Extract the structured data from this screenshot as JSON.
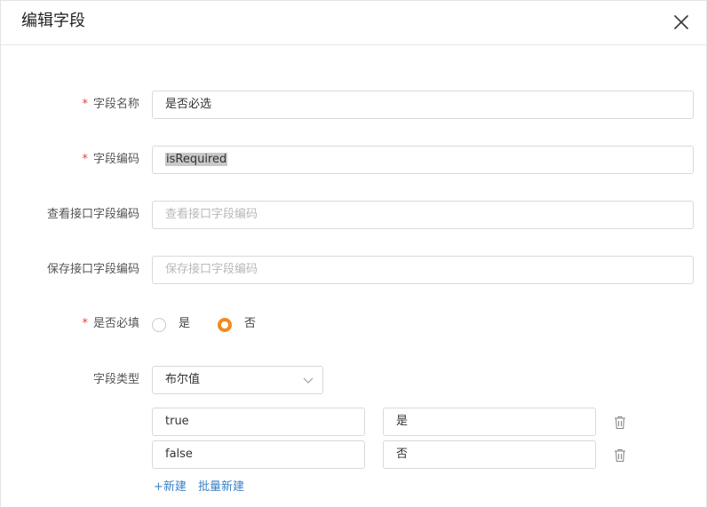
{
  "dialog": {
    "title": "编辑字段"
  },
  "form": {
    "field_name": {
      "label": "字段名称",
      "required": "*",
      "value": "是否必选"
    },
    "field_code": {
      "label": "字段编码",
      "required": "*",
      "value": "isRequired"
    },
    "view_api_code": {
      "label": "查看接口字段编码",
      "placeholder": "查看接口字段编码"
    },
    "save_api_code": {
      "label": "保存接口字段编码",
      "placeholder": "保存接口字段编码"
    },
    "is_required": {
      "label": "是否必填",
      "required": "*",
      "options": [
        {
          "label": "是",
          "selected": false
        },
        {
          "label": "否",
          "selected": true
        }
      ]
    },
    "field_type": {
      "label": "字段类型",
      "value": "布尔值"
    },
    "options": [
      {
        "value": "true",
        "text": "是"
      },
      {
        "value": "false",
        "text": "否"
      }
    ],
    "add_link": "+新建",
    "batch_add_link": "批量新建"
  },
  "colors": {
    "accent": "#f08c1e",
    "link": "#3b82c4",
    "required": "#e0453a"
  }
}
